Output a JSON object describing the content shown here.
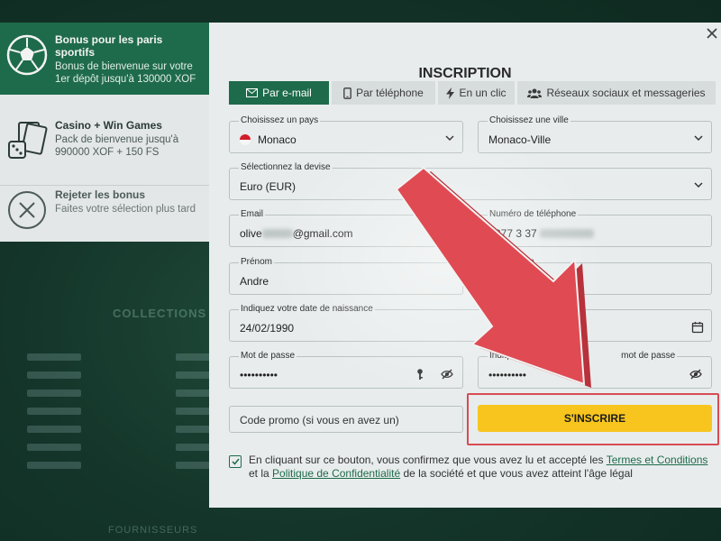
{
  "background": {
    "collections_label": "COLLECTIONS",
    "footer_label": "FOURNISSEURS"
  },
  "bonus": {
    "sport": {
      "title": "Bonus pour les paris sportifs",
      "desc": "Bonus de bienvenue sur votre 1er dépôt jusqu'à 130000 XOF",
      "icon": "soccer-ball-icon"
    },
    "casino": {
      "title": "Casino + Win Games",
      "desc": "Pack de bienvenue jusqu'à 990000 XOF + 150 FS",
      "icon": "cards-dice-icon"
    },
    "reject": {
      "title": "Rejeter les bonus",
      "desc": "Faites votre sélection plus tard",
      "icon": "close-circle-icon"
    }
  },
  "modal": {
    "title": "INSCRIPTION",
    "tabs": [
      {
        "label": "Par e-mail",
        "icon": "envelope-icon",
        "active": true
      },
      {
        "label": "Par téléphone",
        "icon": "phone-icon",
        "active": false
      },
      {
        "label": "En un clic",
        "icon": "lightning-icon",
        "active": false
      },
      {
        "label": "Réseaux sociaux et messageries",
        "icon": "users-icon",
        "active": false
      }
    ],
    "fields": {
      "country": {
        "label": "Choisissez un pays",
        "value": "Monaco"
      },
      "city": {
        "label": "Choisissez une ville",
        "value": "Monaco-Ville"
      },
      "currency": {
        "label": "Sélectionnez la devise",
        "value": "Euro (EUR)"
      },
      "email": {
        "label": "Email",
        "value_start": "olive",
        "value_end": "@gmail.com"
      },
      "phone": {
        "label": "Numéro de téléphone",
        "value": "+377 3 37"
      },
      "firstname": {
        "label": "Prénom",
        "value": "Andre"
      },
      "lastname": {
        "label": "om"
      },
      "birthdate": {
        "label": "Indiquez votre date de naissance",
        "value": "24/02/1990"
      },
      "password": {
        "label": "Mot de passe",
        "value": "••••••••••"
      },
      "password_confirm": {
        "label_start": "Indiquez d",
        "label_end": "mot de passe",
        "value": "••••••••••"
      }
    },
    "promo_placeholder": "Code promo (si vous en avez un)",
    "signup_button": "S'INSCRIRE",
    "consent": {
      "text_1": "En cliquant sur ce bouton, vous confirmez que vous avez lu et accepté les ",
      "link_terms": "Termes et Conditions",
      "text_2": " et la ",
      "link_privacy": "Politique de Confidentialité",
      "text_3": " de la société et que vous avez atteint l'âge légal"
    }
  },
  "colors": {
    "brand_green": "#1e6b4b",
    "button_yellow": "#f7c51e",
    "arrow_red": "#e04a52",
    "highlight_border": "#d74b55"
  }
}
